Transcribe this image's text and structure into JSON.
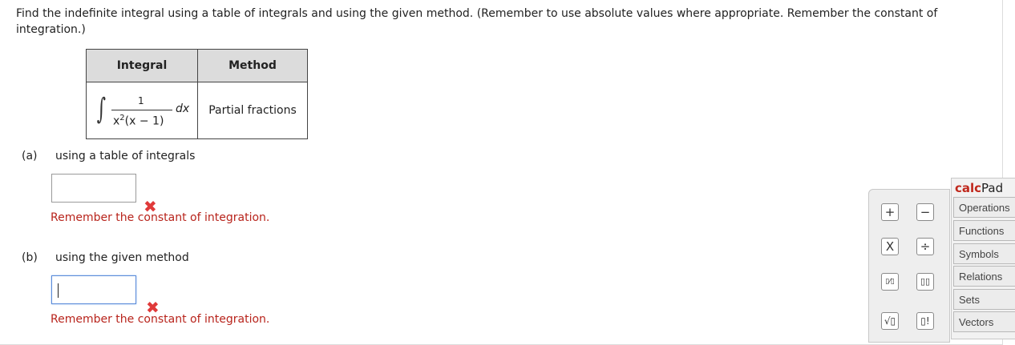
{
  "instructions": "Find the indefinite integral using a table of integrals and using the given method. (Remember to use absolute values where appropriate. Remember the constant of integration.)",
  "table": {
    "headers": [
      "Integral",
      "Method"
    ],
    "integral": {
      "numerator": "1",
      "denominator_base": "x",
      "denominator_exp": "2",
      "denominator_rest": "(x − 1)",
      "differential": "dx"
    },
    "method": "Partial fractions"
  },
  "parts": [
    {
      "letter": "(a)",
      "label": "using a table of integrals",
      "input_value": "",
      "feedback": "Remember the constant of integration."
    },
    {
      "letter": "(b)",
      "label": "using the given method",
      "input_value": "",
      "feedback": "Remember the constant of integration."
    }
  ],
  "calcpad": {
    "brand": "calc",
    "title_rest": "Pad",
    "tabs": [
      "Operations",
      "Functions",
      "Symbols",
      "Relations",
      "Sets",
      "Vectors"
    ],
    "keys": [
      "+",
      "−",
      "X",
      "÷",
      "▯⁄▯",
      "▯▯",
      "√▯",
      "▯!"
    ]
  },
  "colors": {
    "error": "#e03a3a",
    "feedback": "#b8241c",
    "brand": "#c0281c",
    "focus": "#5b8bd9"
  }
}
